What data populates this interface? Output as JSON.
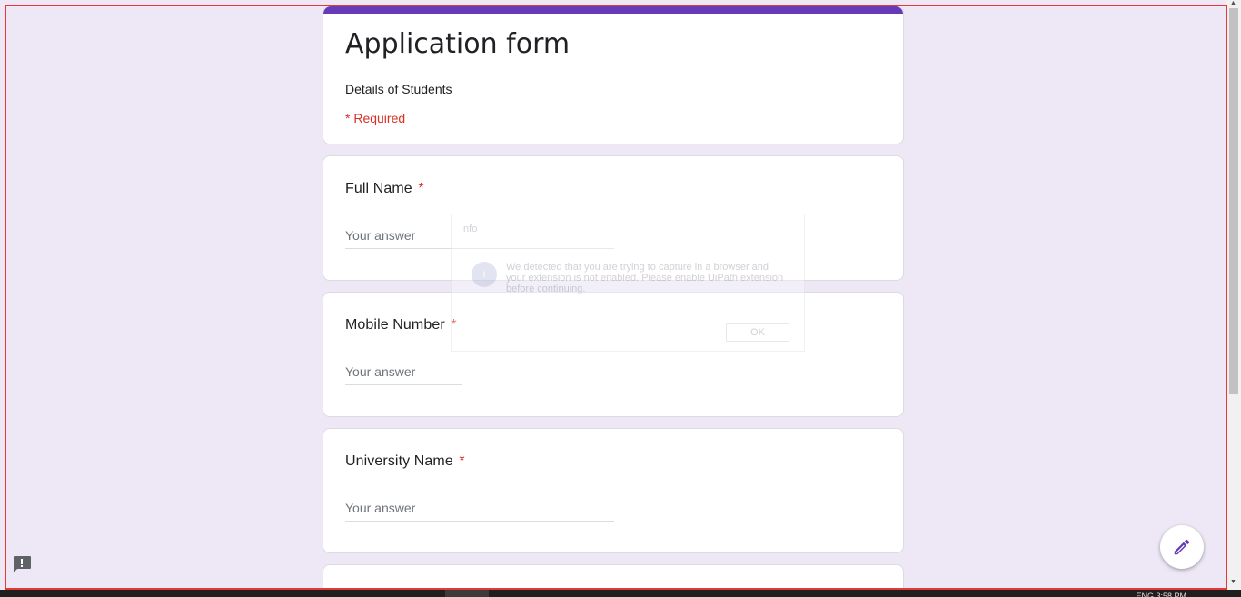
{
  "form": {
    "title": "Application form",
    "description": "Details of Students",
    "required_note": "* Required",
    "accent_color": "#673ab7",
    "questions": [
      {
        "label": "Full Name",
        "required_mark": "*",
        "placeholder": "Your answer"
      },
      {
        "label": "Mobile Number",
        "required_mark": "*",
        "placeholder": "Your answer"
      },
      {
        "label": "University Name",
        "required_mark": "*",
        "placeholder": "Your answer"
      }
    ]
  },
  "overlay_dialog": {
    "title": "Info",
    "message": "We detected that you are trying to capture in a browser and your extension is not enabled. Please enable UiPath extension before continuing.",
    "ok_label": "OK"
  },
  "fab": {
    "icon": "pencil-icon"
  },
  "feedback": {
    "icon": "report-problem-icon"
  },
  "taskbar": {
    "clock": "ENG 3:58 PM"
  }
}
